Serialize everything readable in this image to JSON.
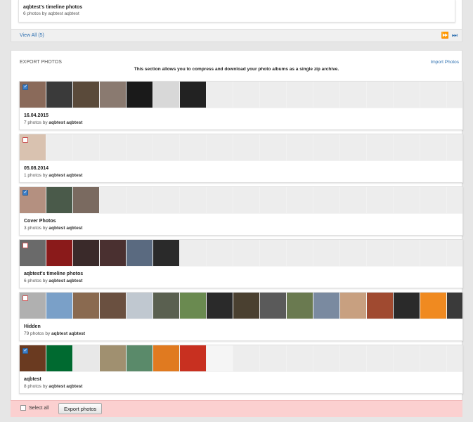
{
  "top_card": {
    "title": "aqbtest's timeline photos",
    "meta": "6 photos by aqbtest aqbtest"
  },
  "top_footer": {
    "view_all": "View All (5)",
    "next_icon": "⏩",
    "last_icon": "⏭"
  },
  "export": {
    "title": "EXPORT PHOTOS",
    "import_link": "Import Photos",
    "description": "This section allows you to compress and download your photo albums as a single zip archive."
  },
  "albums": [
    {
      "name": "16.04.2015",
      "count_text": "7 photos by",
      "owner": "aqbtest aqbtest",
      "checked": true,
      "colors": [
        "#8a6a5a",
        "#3a3a3a",
        "#5a4a3a",
        "#8a7a70",
        "#1a1a1a",
        "#d8d8d8",
        "#222222"
      ]
    },
    {
      "name": "05.08.2014",
      "count_text": "1 photos by",
      "owner": "aqbtest aqbtest",
      "checked": false,
      "colors": [
        "#d9c2b0"
      ]
    },
    {
      "name": "Cover Photos",
      "count_text": "3 photos by",
      "owner": "aqbtest aqbtest",
      "checked": true,
      "colors": [
        "#b49080",
        "#4a5a4a",
        "#7a6a60"
      ]
    },
    {
      "name": "aqbtest's timeline photos",
      "count_text": "6 photos by",
      "owner": "aqbtest aqbtest",
      "checked": false,
      "colors": [
        "#6a6a6a",
        "#8a1a1a",
        "#3a2a2a",
        "#4a3030",
        "#5a6a80",
        "#2a2a2a"
      ]
    },
    {
      "name": "Hidden",
      "count_text": "79 photos by",
      "owner": "aqbtest aqbtest",
      "checked": false,
      "colors": [
        "#b0b0b0",
        "#7aa0c8",
        "#8a6a50",
        "#6a5040",
        "#c0c8d0",
        "#5a6050",
        "#6a8a50",
        "#2a2a2a",
        "#4a4030",
        "#5a5a5a",
        "#6a7a50",
        "#7a8aa0",
        "#c8a080",
        "#a04a30",
        "#2a2a2a",
        "#f08a20",
        "#3a3a3a",
        "#4a4a4a",
        "#6a6a6a"
      ]
    },
    {
      "name": "aqbtest",
      "count_text": "8 photos by",
      "owner": "aqbtest aqbtest",
      "checked": true,
      "colors": [
        "#6a3a20",
        "#006a30",
        "#e8e8e8",
        "#a09070",
        "#5a8a6a",
        "#e07a20",
        "#c83020",
        "#f5f5f5"
      ]
    }
  ],
  "footer": {
    "select_all": "Select all",
    "export_button": "Export photos"
  }
}
